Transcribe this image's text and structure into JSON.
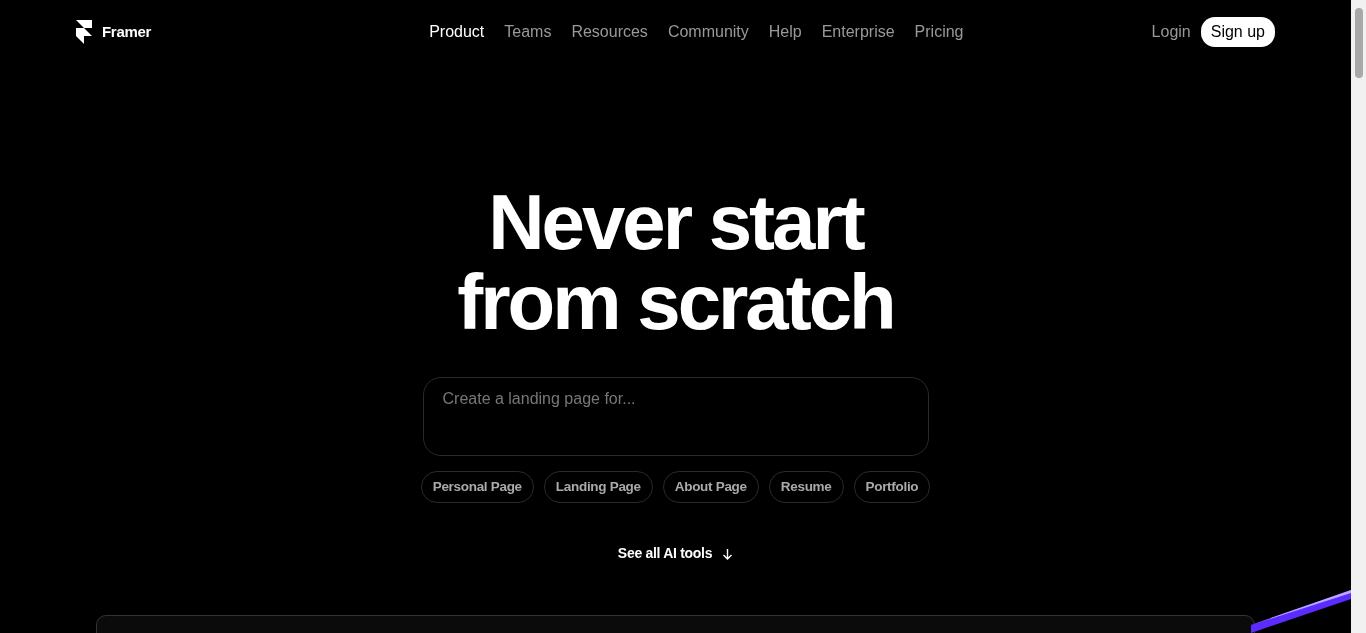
{
  "brand": {
    "name": "Framer"
  },
  "nav": [
    {
      "label": "Product",
      "selected": true
    },
    {
      "label": "Teams",
      "selected": false
    },
    {
      "label": "Resources",
      "selected": false
    },
    {
      "label": "Community",
      "selected": false
    },
    {
      "label": "Help",
      "selected": false
    },
    {
      "label": "Enterprise",
      "selected": false
    },
    {
      "label": "Pricing",
      "selected": false
    }
  ],
  "auth": {
    "login": "Login",
    "signup": "Sign up"
  },
  "hero": {
    "title_lines": [
      "Never start",
      "from scratch"
    ],
    "prompt": {
      "placeholder": "Create a landing page for..."
    },
    "suggestions": [
      "Personal Page",
      "Landing Page",
      "About Page",
      "Resume",
      "Portfolio"
    ],
    "link": "See all AI tools"
  }
}
